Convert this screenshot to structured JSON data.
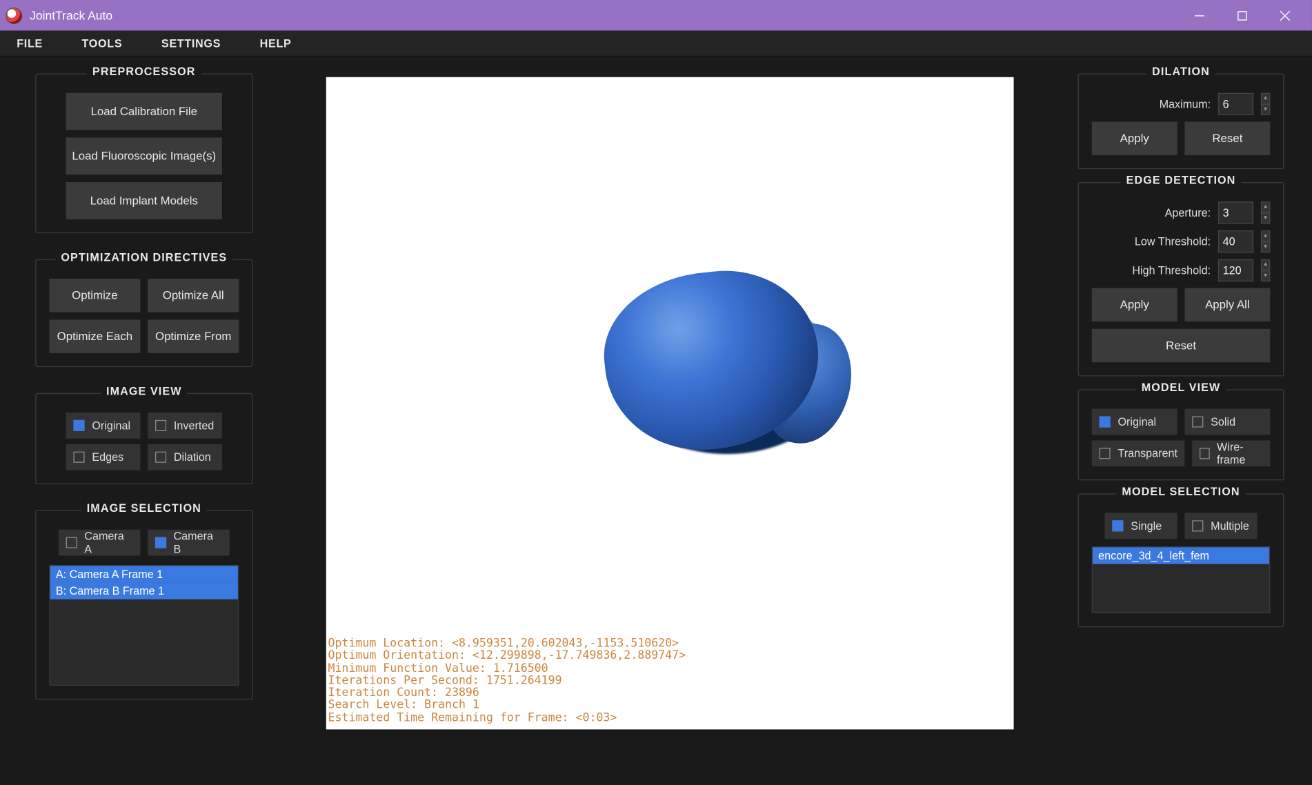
{
  "window": {
    "title": "JointTrack Auto"
  },
  "menubar": {
    "items": [
      "FILE",
      "TOOLS",
      "SETTINGS",
      "HELP"
    ]
  },
  "preprocessor": {
    "title": "PREPROCESSOR",
    "load_calib": "Load Calibration File",
    "load_fluo": "Load Fluoroscopic Image(s)",
    "load_implant": "Load Implant Models"
  },
  "optdir": {
    "title": "OPTIMIZATION DIRECTIVES",
    "optimize": "Optimize",
    "optimize_all": "Optimize All",
    "optimize_each": "Optimize Each",
    "optimize_from": "Optimize From"
  },
  "imageview": {
    "title": "IMAGE VIEW",
    "original": "Original",
    "inverted": "Inverted",
    "edges": "Edges",
    "dilation": "Dilation"
  },
  "imagesel": {
    "title": "IMAGE SELECTION",
    "camera_a": "Camera A",
    "camera_b": "Camera B",
    "items": [
      "A: Camera A Frame 1",
      "B: Camera B Frame 1"
    ]
  },
  "dilation": {
    "title": "DILATION",
    "max_label": "Maximum:",
    "max_value": "6",
    "apply": "Apply",
    "reset": "Reset"
  },
  "edge": {
    "title": "EDGE DETECTION",
    "aperture_label": "Aperture:",
    "aperture_value": "3",
    "low_label": "Low Threshold:",
    "low_value": "40",
    "high_label": "High Threshold:",
    "high_value": "120",
    "apply": "Apply",
    "apply_all": "Apply All",
    "reset": "Reset"
  },
  "modelview": {
    "title": "MODEL VIEW",
    "original": "Original",
    "solid": "Solid",
    "transparent": "Transparent",
    "wireframe": "Wire-frame"
  },
  "modelsel": {
    "title": "MODEL SELECTION",
    "single": "Single",
    "multiple": "Multiple",
    "items": [
      "encore_3d_4_left_fem"
    ]
  },
  "overlay": {
    "text": "Optimum Location: <8.959351,20.602043,-1153.510620>\nOptimum Orientation: <12.299898,-17.749836,2.889747>\nMinimum Function Value: 1.716500\nIterations Per Second: 1751.264199\nIteration Count: 23896\nSearch Level: Branch 1\nEstimated Time Remaining for Frame: <0:03>"
  }
}
